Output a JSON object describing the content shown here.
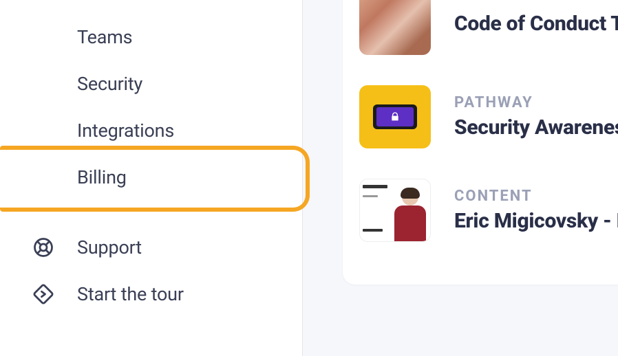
{
  "sidebar": {
    "items": [
      {
        "label": "Teams"
      },
      {
        "label": "Security"
      },
      {
        "label": "Integrations"
      },
      {
        "label": "Billing"
      }
    ],
    "support_label": "Support",
    "tour_label": "Start the tour"
  },
  "content": {
    "rows": [
      {
        "kicker": "",
        "title": "Code of Conduct Tra"
      },
      {
        "kicker": "PATHWAY",
        "title": "Security Awareness"
      },
      {
        "kicker": "CONTENT",
        "title": "Eric Migicovsky - Ho"
      }
    ]
  }
}
